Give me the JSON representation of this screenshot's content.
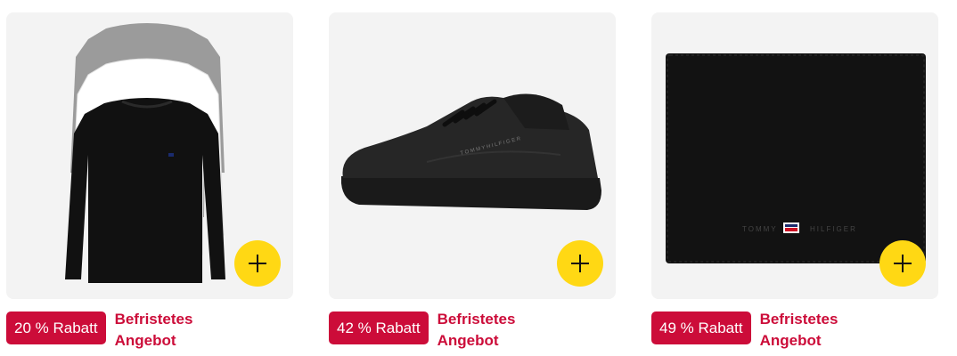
{
  "colors": {
    "deal_badge": "#cc0c39",
    "add_button": "#ffd814",
    "card_bg": "#f3f3f3"
  },
  "products": [
    {
      "image": "long-sleeve-shirts-3pack",
      "add_icon": "plus-icon",
      "discount": "20 % Rabatt",
      "deal_line1": "Befristetes",
      "deal_line2": "Angebot"
    },
    {
      "image": "black-sneaker",
      "add_icon": "plus-icon",
      "discount": "42 % Rabatt",
      "deal_line1": "Befristetes",
      "deal_line2": "Angebot"
    },
    {
      "image": "black-wallet",
      "add_icon": "plus-icon",
      "discount": "49 % Rabatt",
      "deal_line1": "Befristetes",
      "deal_line2": "Angebot"
    }
  ]
}
